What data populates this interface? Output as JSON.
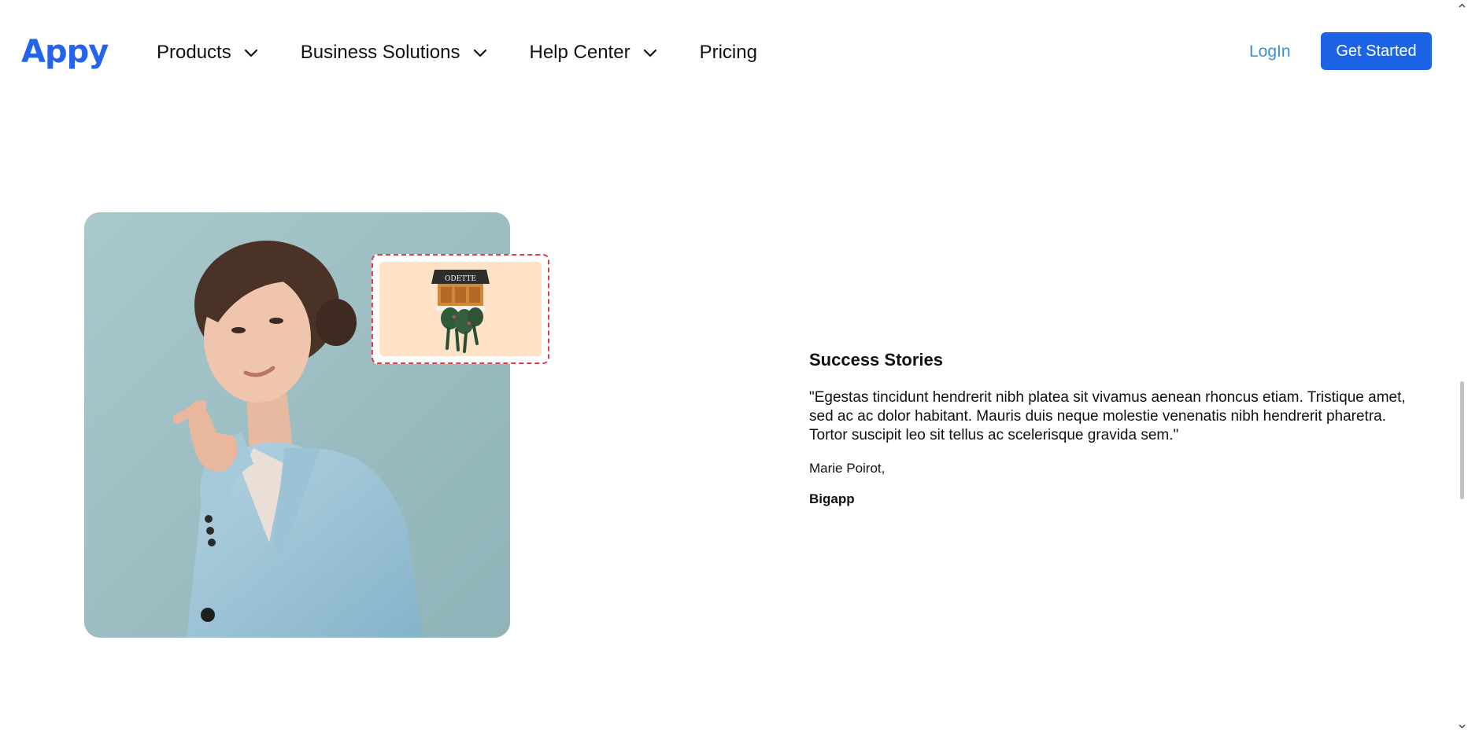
{
  "nav": {
    "logo": "Appy",
    "items": [
      {
        "label": "Products",
        "has_dropdown": true,
        "icon": "chevron-down-icon"
      },
      {
        "label": "Business Solutions",
        "has_dropdown": true,
        "icon": "chevron-down-icon"
      },
      {
        "label": "Help Center",
        "has_dropdown": true,
        "icon": "chevron-down-icon"
      },
      {
        "label": "Pricing",
        "has_dropdown": false
      }
    ],
    "login_label": "LogIn",
    "cta_label": "Get Started"
  },
  "testimonial": {
    "title": "Success Stories",
    "quote": "\"Egestas tincidunt hendrerit nibh platea sit vivamus aenean rhoncus etiam. Tristique amet, sed ac ac dolor habitant. Mauris duis neque molestie venenatis nibh hendrerit pharetra. Tortor suscipit leo sit tellus ac scelerisque gravida sem.\"",
    "author": "Marie Poirot,",
    "company": "Bigapp"
  },
  "thumbnail": {
    "sign_text": "ODETTE"
  },
  "colors": {
    "brand": "#2563eb",
    "cta": "#1d63e6",
    "login": "#3b8fd8",
    "photo_bg": "#9fc2c6",
    "thumb_bg": "#fde2c8",
    "thumb_border": "#e23a4a"
  }
}
